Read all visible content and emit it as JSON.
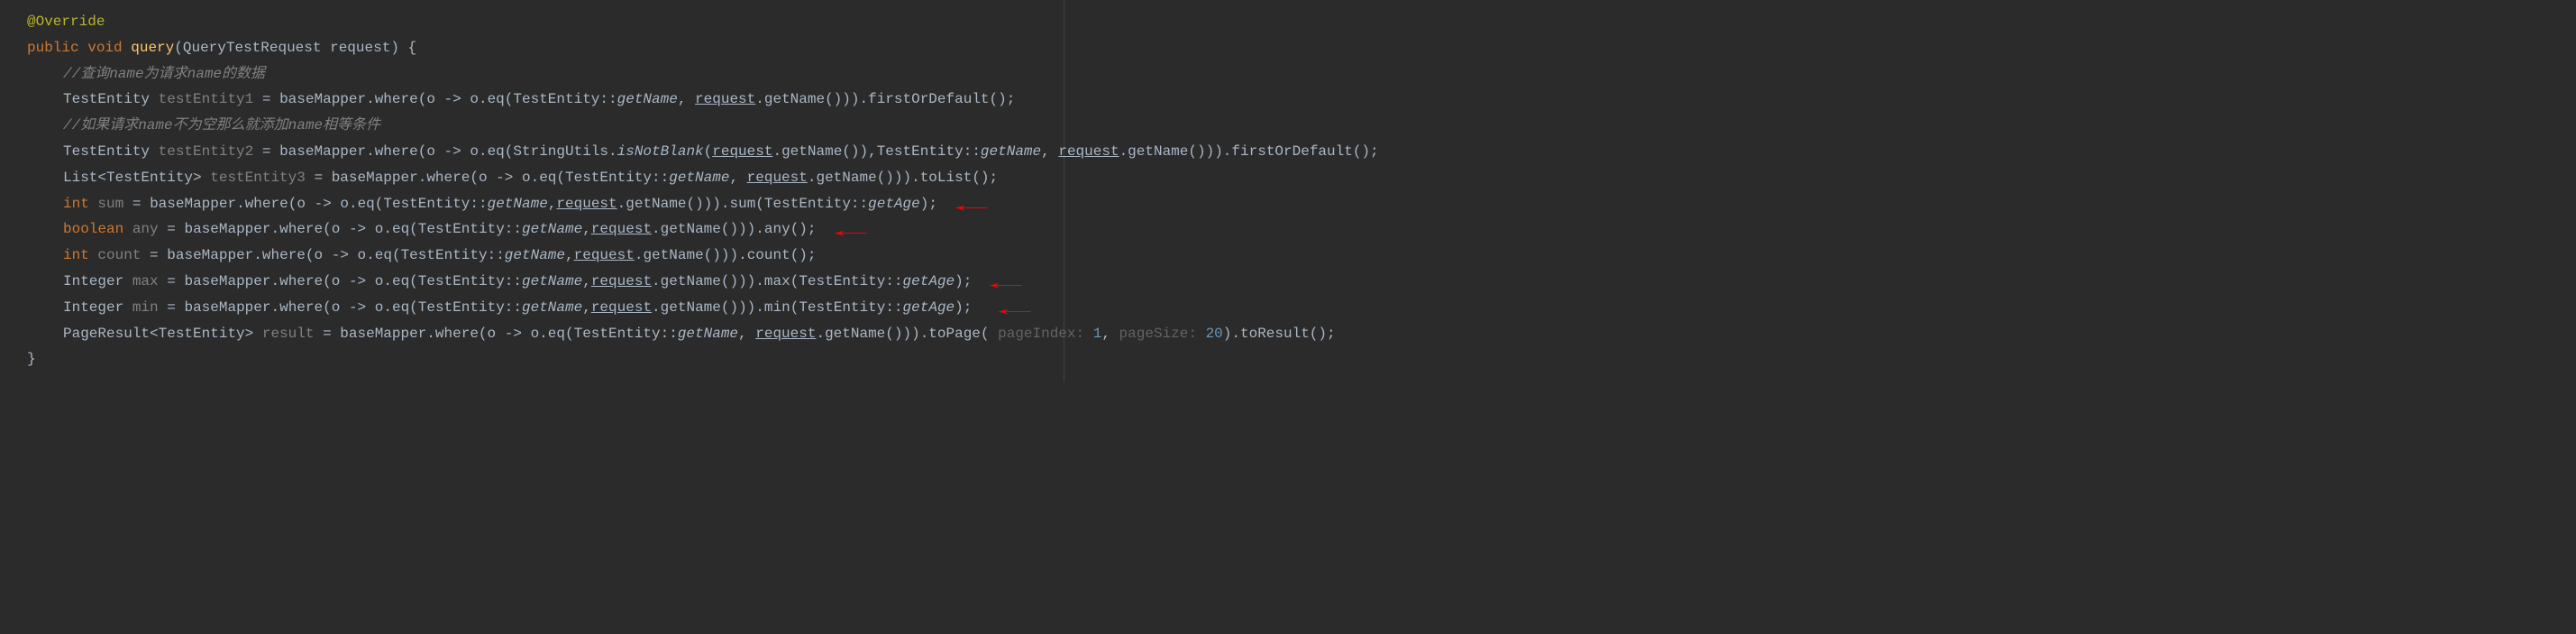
{
  "lines": {
    "override": "@Override",
    "public": "public",
    "void": "void",
    "query": "query",
    "paramType": "QueryTestRequest",
    "paramName": "request",
    "openBrace": "{",
    "closeBrace": "}",
    "comment1": "//查询name为请求name的数据",
    "comment2": "//如果请求name不为空那么就添加name相等条件",
    "testEntity": "TestEntity",
    "testEntity1": "testEntity1",
    "testEntity2": "testEntity2",
    "testEntity3": "testEntity3",
    "list": "List",
    "int": "int",
    "boolean": "boolean",
    "integer": "Integer",
    "pageResult": "PageResult",
    "sum": "sum",
    "any": "any",
    "count": "count",
    "max": "max",
    "min": "min",
    "result": "result",
    "baseMapper": "baseMapper",
    "where": "where",
    "eq": "eq",
    "getName": "getName",
    "getAge": "getAge",
    "firstOrDefault": "firstOrDefault",
    "toList": "toList",
    "toPage": "toPage",
    "toResult": "toResult",
    "stringUtils": "StringUtils",
    "isNotBlank": "isNotBlank",
    "request": "request",
    "lambda": "o -> o",
    "pageIndexHint": "pageIndex:",
    "pageSizeHint": "pageSize:",
    "pageIndexVal": "1",
    "pageSizeVal": "20",
    "eq_": "=",
    "o": "o",
    "arrow_sym": "->",
    "colon2": "::"
  }
}
